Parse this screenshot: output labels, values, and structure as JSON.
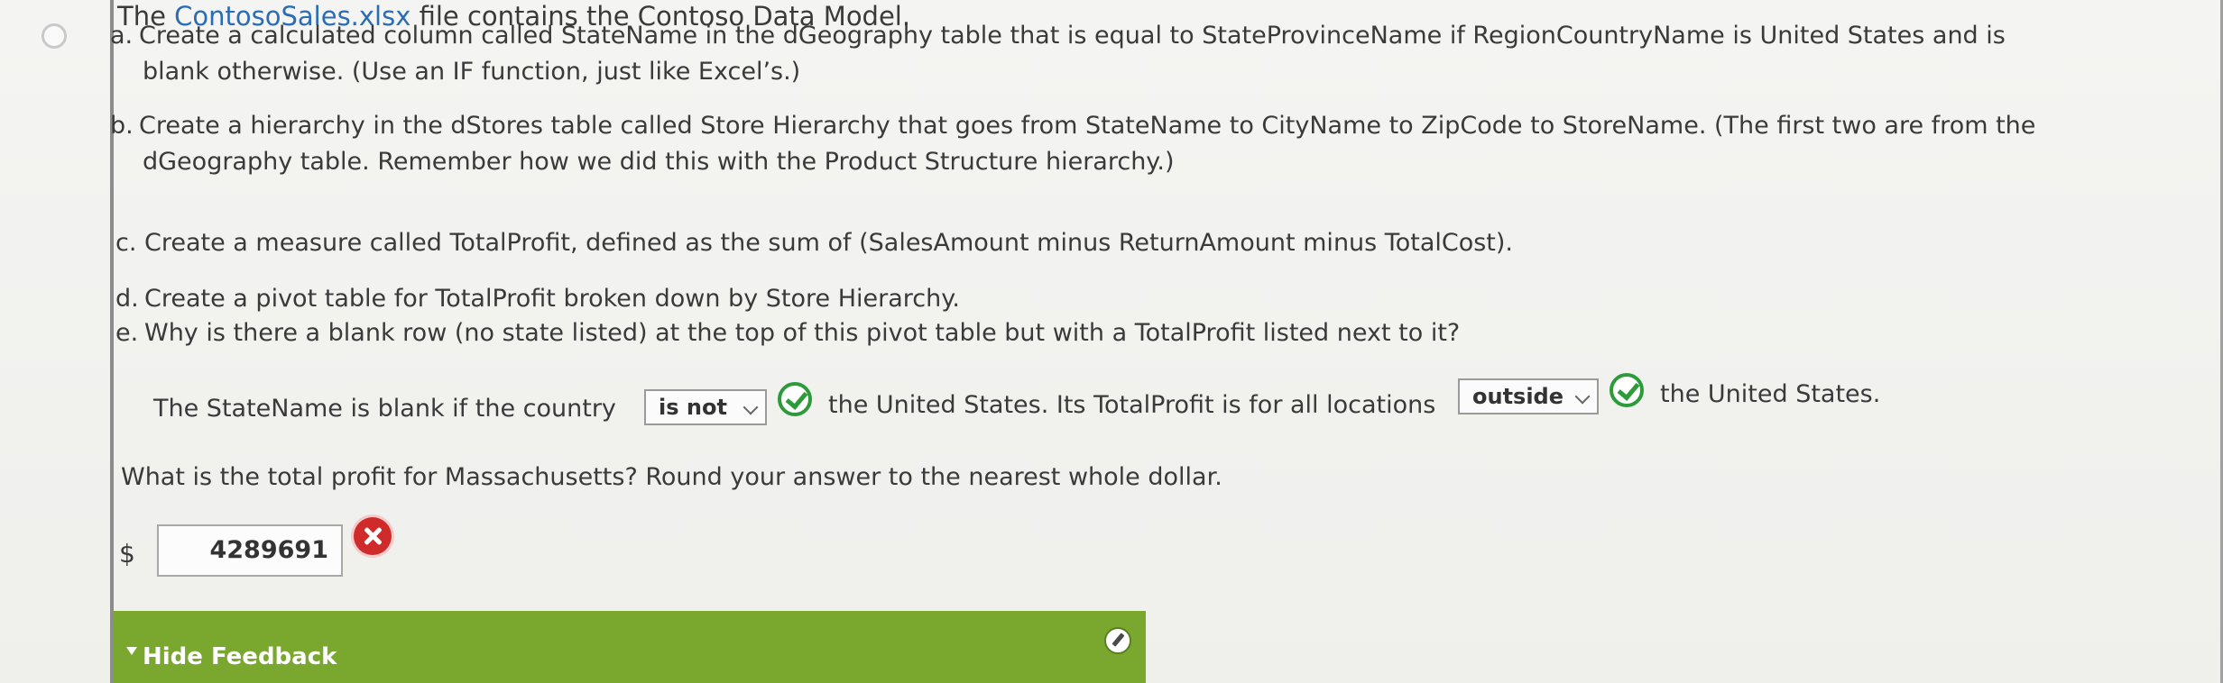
{
  "intro": {
    "prefix": "The ",
    "link": "ContosoSales.xlsx",
    "suffix": " file contains the Contoso Data Model."
  },
  "items": [
    {
      "marker": "a.",
      "line1": "Create a calculated column called StateName in the dGeography table that is equal to StateProvinceName if RegionCountryName is United States and is",
      "line2": "blank otherwise. (Use an IF function, just like Excel’s.)"
    },
    {
      "marker": "b.",
      "line1": "Create a hierarchy in the dStores table called Store Hierarchy that goes from StateName to CityName to ZipCode to StoreName. (The first two are from the",
      "line2": "dGeography table. Remember how we did this with the Product Structure hierarchy.)"
    },
    {
      "marker": "c.",
      "line1": "Create a measure called TotalProfit, defined as the sum of (SalesAmount minus ReturnAmount minus TotalCost)."
    },
    {
      "marker": "d.",
      "line1": "Create a pivot table for TotalProfit broken down by Store Hierarchy."
    },
    {
      "marker": "e.",
      "line1": "Why is there a blank row (no state listed) at the top of this pivot table but with a TotalProfit listed next to it?"
    }
  ],
  "answer_sentence": {
    "part1": "The StateName is blank if the country",
    "select1": "is not",
    "part2": "the United States. Its TotalProfit is for all locations",
    "select2": "outside",
    "part3": "the United States."
  },
  "question": "What is the total profit for Massachusetts? Round your answer to the nearest whole dollar.",
  "currency_symbol": "$",
  "answer_value": "4289691",
  "feedback_toggle": "Hide Feedback",
  "colors": {
    "link": "#2a6db5",
    "correct": "#2d9b3a",
    "incorrect": "#cf2b2b",
    "feedback_bar": "#7aa72d"
  }
}
